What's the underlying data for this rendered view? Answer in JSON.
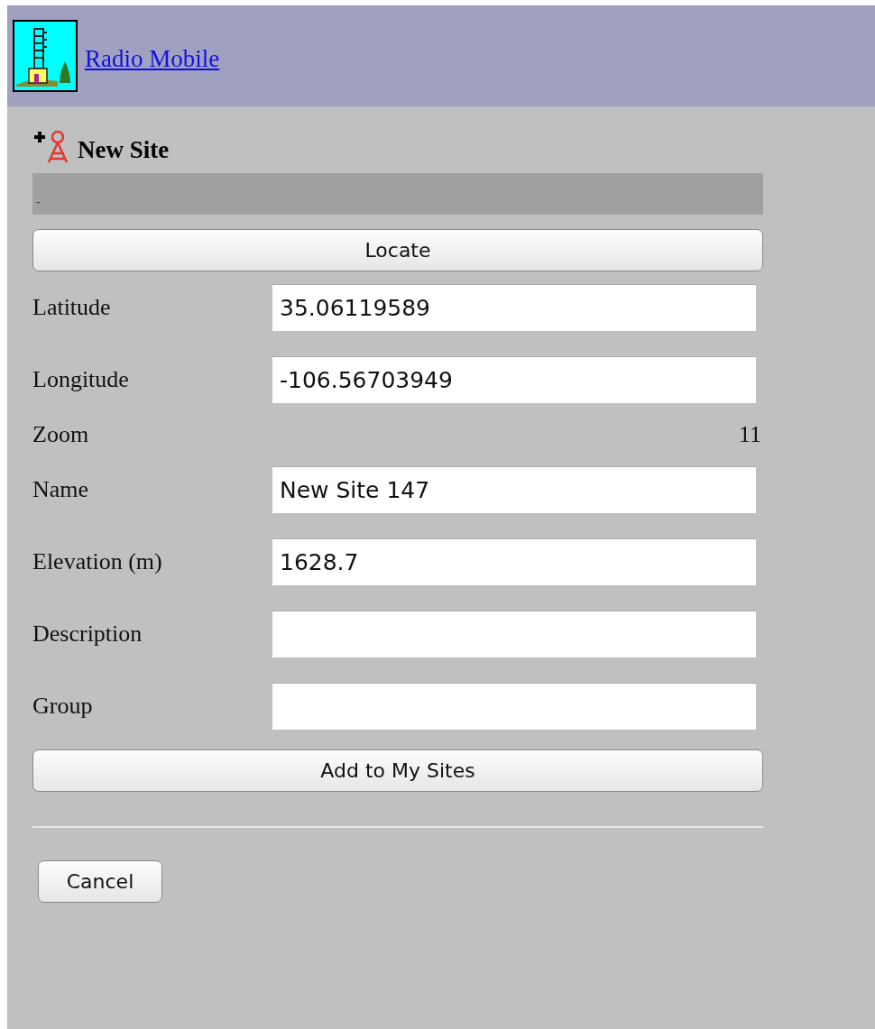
{
  "header": {
    "title": "Radio Mobile"
  },
  "form": {
    "title": "New Site",
    "status": "-",
    "locate_button": "Locate",
    "fields": [
      {
        "label": "Latitude",
        "kind": "input",
        "value": "35.06119589"
      },
      {
        "label": "Longitude",
        "kind": "input",
        "value": "-106.56703949"
      },
      {
        "label": "Zoom",
        "kind": "text",
        "value": "11"
      },
      {
        "label": "Name",
        "kind": "input",
        "value": "New Site 147"
      },
      {
        "label": "Elevation (m)",
        "kind": "input",
        "value": "1628.7"
      },
      {
        "label": "Description",
        "kind": "input"
      },
      {
        "label": "Group",
        "kind": "input"
      }
    ],
    "add_button": "Add to My Sites",
    "cancel_button": "Cancel"
  }
}
